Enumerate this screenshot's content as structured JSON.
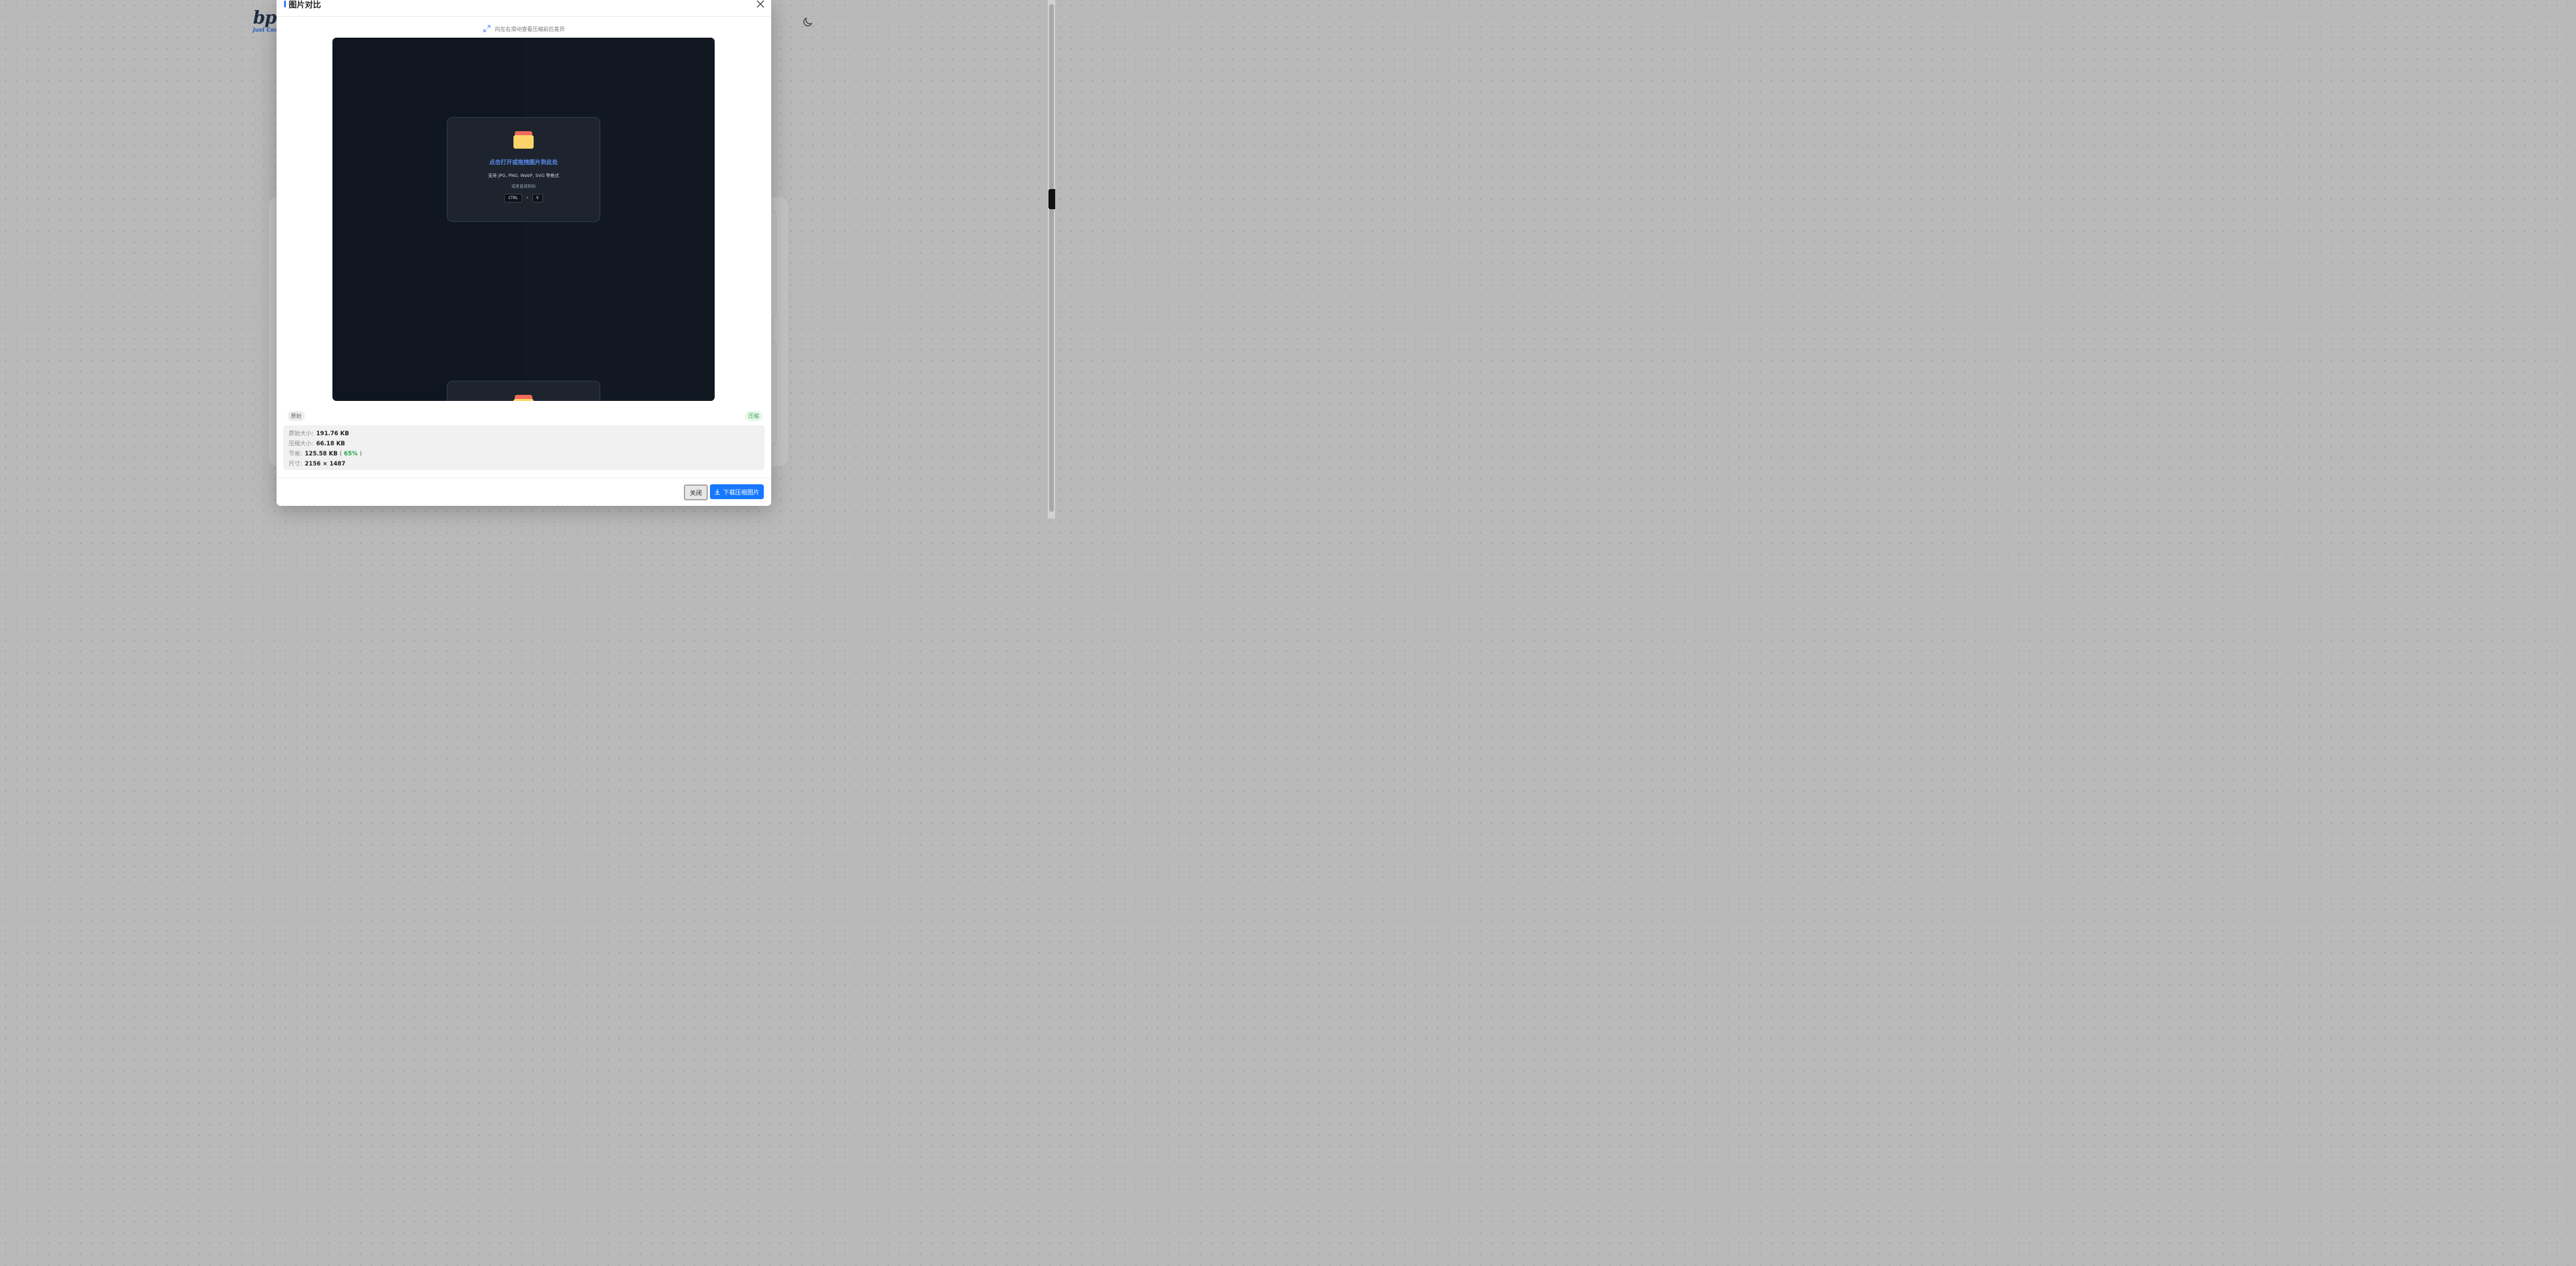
{
  "background": {
    "logo_text": "bpl",
    "logo_sub": "Just Com"
  },
  "modal": {
    "title": "图片对比",
    "hint": "向左右滑动查看压缩前后差异",
    "preview": {
      "drop_title": "点击打开或拖拽图片到此处",
      "drop_formats": "支持 JPG, PNG, WebP, SVG 等格式",
      "drop_paste": "或者直接粘贴",
      "key_ctrl": "CTRL",
      "key_plus": "+",
      "key_v": "V"
    },
    "tags": {
      "original": "原始",
      "compressed": "压缩"
    },
    "stats": {
      "original_size_label": "原始大小:",
      "original_size": "191.76 KB",
      "compressed_size_label": "压缩大小:",
      "compressed_size": "66.18 KB",
      "saved_label": "节省:",
      "saved": "125.58 KB",
      "paren_open": "(",
      "saved_percent": "65%",
      "paren_close": ")",
      "dimensions_label": "尺寸:",
      "dimensions": "2156 × 1487"
    },
    "buttons": {
      "close": "关闭",
      "download": "下载压缩图片"
    },
    "colors": {
      "accent": "#1677ff",
      "saved_percent": "#22a34b",
      "drop_title": "#5b8def"
    }
  }
}
